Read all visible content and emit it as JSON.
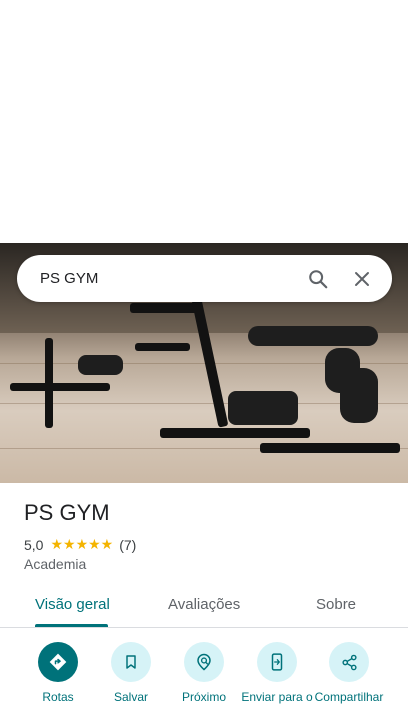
{
  "search": {
    "query": "PS GYM"
  },
  "icons": {
    "search": "search-icon",
    "close": "close-icon"
  },
  "place": {
    "name": "PS GYM",
    "rating": "5,0",
    "stars": "★★★★★",
    "review_count": "(7)",
    "category": "Academia"
  },
  "tabs": [
    {
      "label": "Visão geral",
      "active": true
    },
    {
      "label": "Avaliações",
      "active": false
    },
    {
      "label": "Sobre",
      "active": false
    }
  ],
  "actions": [
    {
      "label": "Rotas",
      "icon": "directions-icon"
    },
    {
      "label": "Salvar",
      "icon": "bookmark-icon"
    },
    {
      "label": "Próximo",
      "icon": "nearby-icon"
    },
    {
      "label": "Enviar para o",
      "icon": "send-to-phone-icon"
    },
    {
      "label": "Compartilhar",
      "icon": "share-icon"
    }
  ],
  "colors": {
    "accent": "#00727a",
    "accent_light": "#d6f3f7",
    "star": "#f4b400"
  }
}
